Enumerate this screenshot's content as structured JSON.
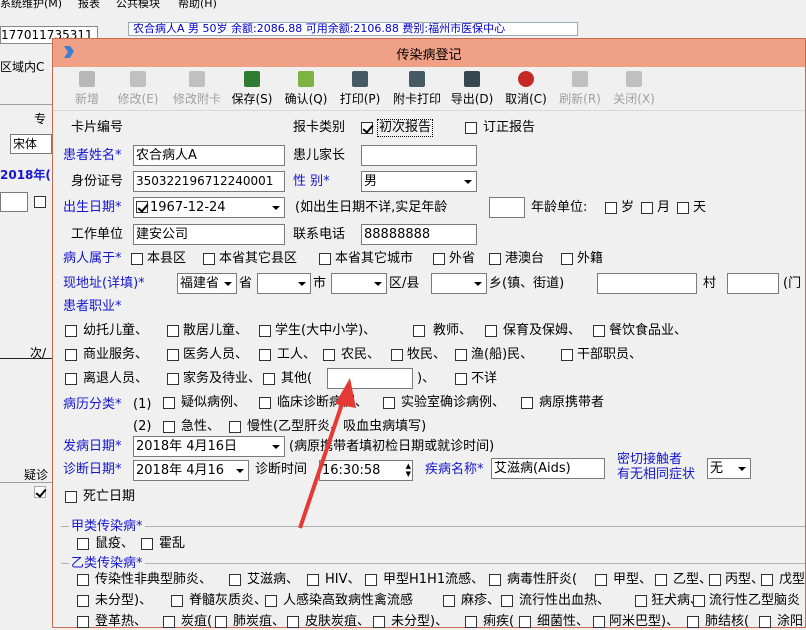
{
  "bg": {
    "menu": [
      "系统维护(M)",
      "报表",
      "公共模块",
      "帮助(H)"
    ],
    "info": "农合病人A 男 50岁 余额:2086.88 可用余额:2106.88 费别:福州市医保中心",
    "field": "177011735311",
    "region": "区域内C",
    "row1": "专",
    "font_name": "宋体",
    "year": "2018年(",
    "times": "次/",
    "col_label": "疑诊"
  },
  "dialog": {
    "title": "传染病登记"
  },
  "toolbar": [
    {
      "label": "新增",
      "enabled": false,
      "icon": "new-icon"
    },
    {
      "label": "修改(E)",
      "enabled": false,
      "icon": "edit-icon"
    },
    {
      "label": "修改附卡",
      "enabled": false,
      "icon": "edit-card-icon"
    },
    {
      "label": "保存(S)",
      "enabled": true,
      "icon": "save-icon"
    },
    {
      "label": "确认(Q)",
      "enabled": true,
      "icon": "confirm-icon"
    },
    {
      "label": "打印(P)",
      "enabled": true,
      "icon": "print-icon"
    },
    {
      "label": "附卡打印",
      "enabled": true,
      "icon": "print-card-icon"
    },
    {
      "label": "导出(D)",
      "enabled": true,
      "icon": "export-icon"
    },
    {
      "label": "取消(C)",
      "enabled": true,
      "icon": "cancel-icon"
    },
    {
      "label": "刷新(R)",
      "enabled": false,
      "icon": "refresh-icon"
    },
    {
      "label": "关闭(X)",
      "enabled": false,
      "icon": "close-icon"
    }
  ],
  "form": {
    "card_no": "卡片编号",
    "report_type": "报卡类别",
    "first_report": "初次报告",
    "revised_report": "订正报告",
    "patient_name_label": "患者姓名*",
    "patient_name": "农合病人A",
    "guardian_label": "患儿家长",
    "id_label": "身份证号",
    "id_value": "350322196712240001",
    "sex_label": "性  别*",
    "sex": "男",
    "birth_label": "出生日期*",
    "birth": "1967-12-24",
    "birth_hint": "(如出生日期不详,实足年龄",
    "age_unit": "年龄单位:",
    "age_units": [
      "岁",
      "月",
      "天"
    ],
    "work_label": "工作单位",
    "work": "建安公司",
    "phone_label": "联系电话",
    "phone": "88888888",
    "belong_label": "病人属于*",
    "belong_opts": [
      "本县区",
      "本省其它县区",
      "本省其它城市",
      "外省",
      "港澳台",
      "外籍"
    ],
    "addr_label": "现地址(详填)*",
    "province": "福建省",
    "addr_units": [
      "省",
      "市",
      "区/县",
      "乡(镇、街道)",
      "村",
      "(门"
    ],
    "occ_label": "患者职业*",
    "occ_row1": [
      "幼托儿童、",
      "散居儿童、",
      "学生(大中小学)、",
      "教师、",
      "保育及保姆、",
      "餐饮食品业、"
    ],
    "occ_row2": [
      "商业服务、",
      "医务人员、",
      "工人、",
      "农民、",
      "牧民、",
      "渔(船)民、",
      "干部职员、"
    ],
    "occ_row3": [
      "离退人员、",
      "家务及待业、",
      "其他(",
      ")、",
      "不详"
    ],
    "case_label": "病历分类*",
    "case1_prefix": "(1)",
    "case1": [
      "疑似病例、",
      "临床诊断病例、",
      "实验室确诊病例、",
      "病原携带者"
    ],
    "case2_prefix": "(2)",
    "case2": [
      "急性、",
      "慢性(乙型肝炎、吸血虫病填写)"
    ],
    "onset_label": "发病日期*",
    "onset": "2018年 4月16日",
    "onset_hint": "(病原携带者填初检日期或就诊时间)",
    "diag_label": "诊断日期*",
    "diag": "2018年 4月16",
    "diag_time_label": "诊断时间",
    "diag_time": "16:30:58",
    "disease_label": "疾病名称*",
    "disease": "艾滋病(Aids)",
    "contact_label1": "密切接触者",
    "contact_label2": "有无相同症状",
    "contact": "无",
    "death_label": "死亡日期",
    "classA_label": "甲类传染病*",
    "classA": [
      "鼠疫、",
      "霍乱"
    ],
    "classB_label": "乙类传染病*",
    "classB_row1": [
      "传染性非典型肺炎、",
      "艾滋病、",
      "HIV、",
      "甲型H1H1流感、",
      "病毒性肝炎(",
      "甲型、",
      "乙型、",
      "丙型、",
      "戊型"
    ],
    "classB_row2": [
      "未分型)、",
      "脊髓灰质炎、",
      "人感染高致病性禽流感",
      "麻疹、",
      "流行性出血热、",
      "狂犬病、",
      "流行性乙型脑炎"
    ],
    "classB_row3": [
      "登革热、",
      "炭疽(",
      "肺炭疽、",
      "皮肤炭疽、",
      "未分型)、",
      "痢疾(",
      "细菌性、",
      "阿米巴型)、",
      "肺结核(",
      "涂阳"
    ]
  }
}
